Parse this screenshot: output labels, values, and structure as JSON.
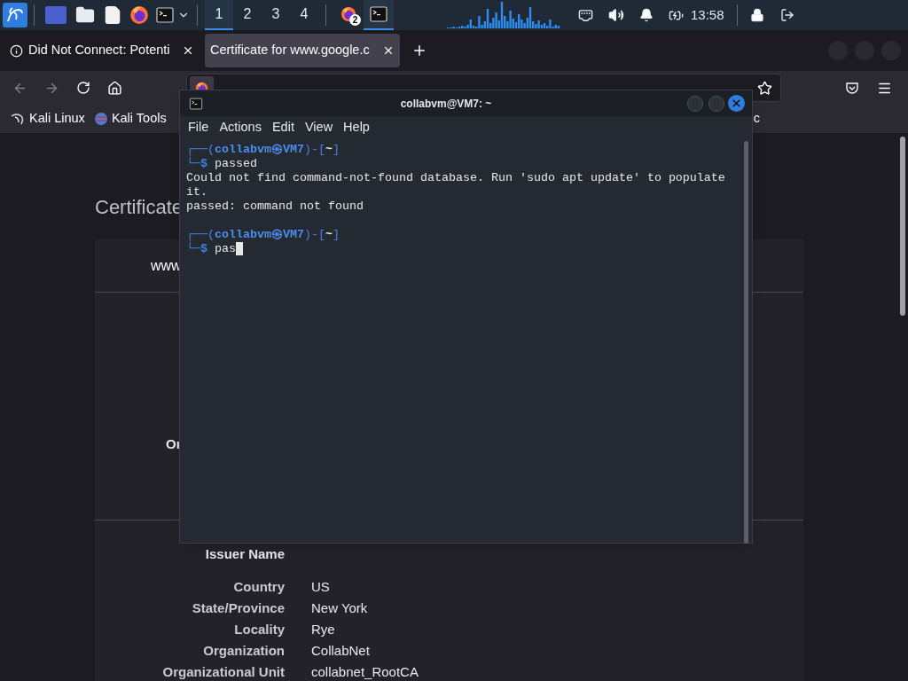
{
  "taskbar": {
    "workspaces": [
      {
        "label": "1",
        "selected": true
      },
      {
        "label": "2",
        "selected": false
      },
      {
        "label": "3",
        "selected": false
      },
      {
        "label": "4",
        "selected": false
      }
    ],
    "windows": [
      {
        "kind": "browser",
        "badge": "2",
        "selected": false
      },
      {
        "kind": "terminal",
        "selected": true
      }
    ],
    "clock": "13:58"
  },
  "browser": {
    "tabs": [
      {
        "title": "Did Not Connect: Potenti",
        "info": true,
        "selected": false
      },
      {
        "title": "Certificate for www.google.c",
        "info": false,
        "selected": true
      }
    ],
    "back_disabled": true,
    "forward_disabled": true,
    "bookmarks": [
      "Kali Linux",
      "Kali Tools",
      "c"
    ],
    "page": {
      "heading": "Certificate",
      "card_tab": "www",
      "subject_fragment": "Or",
      "issuer": {
        "title": "Issuer Name",
        "rows": [
          {
            "label": "Country",
            "value": "US"
          },
          {
            "label": "State/Province",
            "value": "New York"
          },
          {
            "label": "Locality",
            "value": "Rye"
          },
          {
            "label": "Organization",
            "value": "CollabNet"
          },
          {
            "label": "Organizational Unit",
            "value": "collabnet_RootCA"
          }
        ]
      }
    }
  },
  "terminal": {
    "title": "collabvm@VM7: ~",
    "menu": [
      "File",
      "Actions",
      "Edit",
      "View",
      "Help"
    ],
    "lines": [
      {
        "kind": "prompt",
        "top": "┌──(",
        "user": "collabvm",
        "at": "㉿",
        "host": "VM7",
        "mid": ")-[",
        "dir": "~",
        "end": "]",
        "bottom": "└─",
        "dollar": "$",
        "command": "passed",
        "cursor": false
      },
      {
        "kind": "output",
        "text": "Could not find command-not-found database. Run 'sudo apt update' to populate it."
      },
      {
        "kind": "output",
        "text": "passed: command not found"
      },
      {
        "kind": "blank"
      },
      {
        "kind": "prompt",
        "top": "┌──(",
        "user": "collabvm",
        "at": "㉿",
        "host": "VM7",
        "mid": ")-[",
        "dir": "~",
        "end": "]",
        "bottom": "└─",
        "dollar": "$",
        "command": "pas",
        "cursor": true
      }
    ]
  }
}
